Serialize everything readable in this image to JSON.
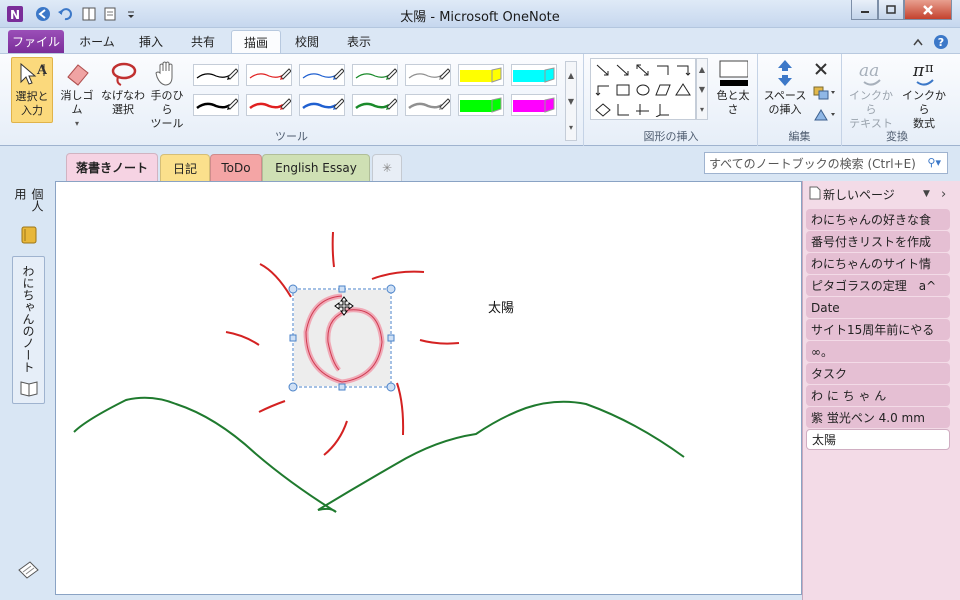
{
  "window": {
    "title": "太陽 - Microsoft OneNote",
    "buttons": [
      "minimize",
      "maximize",
      "close"
    ]
  },
  "ribbon_tabs": [
    {
      "label": "ファイル",
      "selected": false
    },
    {
      "label": "ホーム",
      "selected": false
    },
    {
      "label": "挿入",
      "selected": false
    },
    {
      "label": "共有",
      "selected": false
    },
    {
      "label": "描画",
      "selected": true
    },
    {
      "label": "校閲",
      "selected": false
    },
    {
      "label": "表示",
      "selected": false
    }
  ],
  "ribbon": {
    "tools": {
      "select_label": "選択と\n入力",
      "eraser_label": "消しゴム",
      "lasso_label": "なげなわ\n選択",
      "panning_label": "手のひら\nツール",
      "group_label": "ツール",
      "pens": [
        {
          "color": "#000000",
          "type": "thin"
        },
        {
          "color": "#e02020",
          "type": "thin"
        },
        {
          "color": "#2060d0",
          "type": "thin"
        },
        {
          "color": "#1a8a2a",
          "type": "thin"
        },
        {
          "color": "#909090",
          "type": "thin"
        },
        {
          "color": "#ffff00",
          "type": "highlighter"
        },
        {
          "color": "#00ffff",
          "type": "highlighter"
        },
        {
          "color": "#000000",
          "type": "thick"
        },
        {
          "color": "#e02020",
          "type": "thick"
        },
        {
          "color": "#2060d0",
          "type": "thick"
        },
        {
          "color": "#1a8a2a",
          "type": "thick"
        },
        {
          "color": "#909090",
          "type": "thick"
        },
        {
          "color": "#00ff00",
          "type": "highlighter"
        },
        {
          "color": "#ff00ff",
          "type": "highlighter"
        }
      ]
    },
    "insert_shapes": {
      "group_label": "図形の挿入",
      "color_width_label": "色と太さ"
    },
    "edit": {
      "group_label": "編集",
      "insert_space_label": "スペース\nの挿入"
    },
    "convert": {
      "group_label": "変換",
      "ink_to_text_label": "インクから\nテキスト",
      "ink_to_math_label": "インクから\n数式"
    }
  },
  "notebook": {
    "tabs": [
      {
        "label": "落書きノート",
        "color": "#f6d3e3",
        "selected": true
      },
      {
        "label": "日記",
        "color": "#fbe08c",
        "selected": false
      },
      {
        "label": "ToDo",
        "color": "#f4a5a5",
        "selected": false
      },
      {
        "label": "English Essay",
        "color": "#cfe0b4",
        "selected": false
      }
    ],
    "new_section_icon": "star-icon",
    "search_placeholder": "すべてのノートブックの検索 (Ctrl+E)"
  },
  "left_nav": {
    "notebooks": [
      "個人用",
      "わにちゃんのノート"
    ]
  },
  "page": {
    "title": "太陽"
  },
  "pages_pane": {
    "new_page_label": "新しいページ",
    "items": [
      "わにちゃんの好きな食",
      "番号付きリストを作成",
      "わにちゃんのサイト情",
      "ピタゴラスの定理　a^",
      "Date",
      "サイト15周年前にやる",
      "∞。",
      "タスク",
      "わ に ち ゃ ん",
      "紫 蛍光ペン 4.0 mm",
      "太陽"
    ],
    "selected_index": 10
  }
}
